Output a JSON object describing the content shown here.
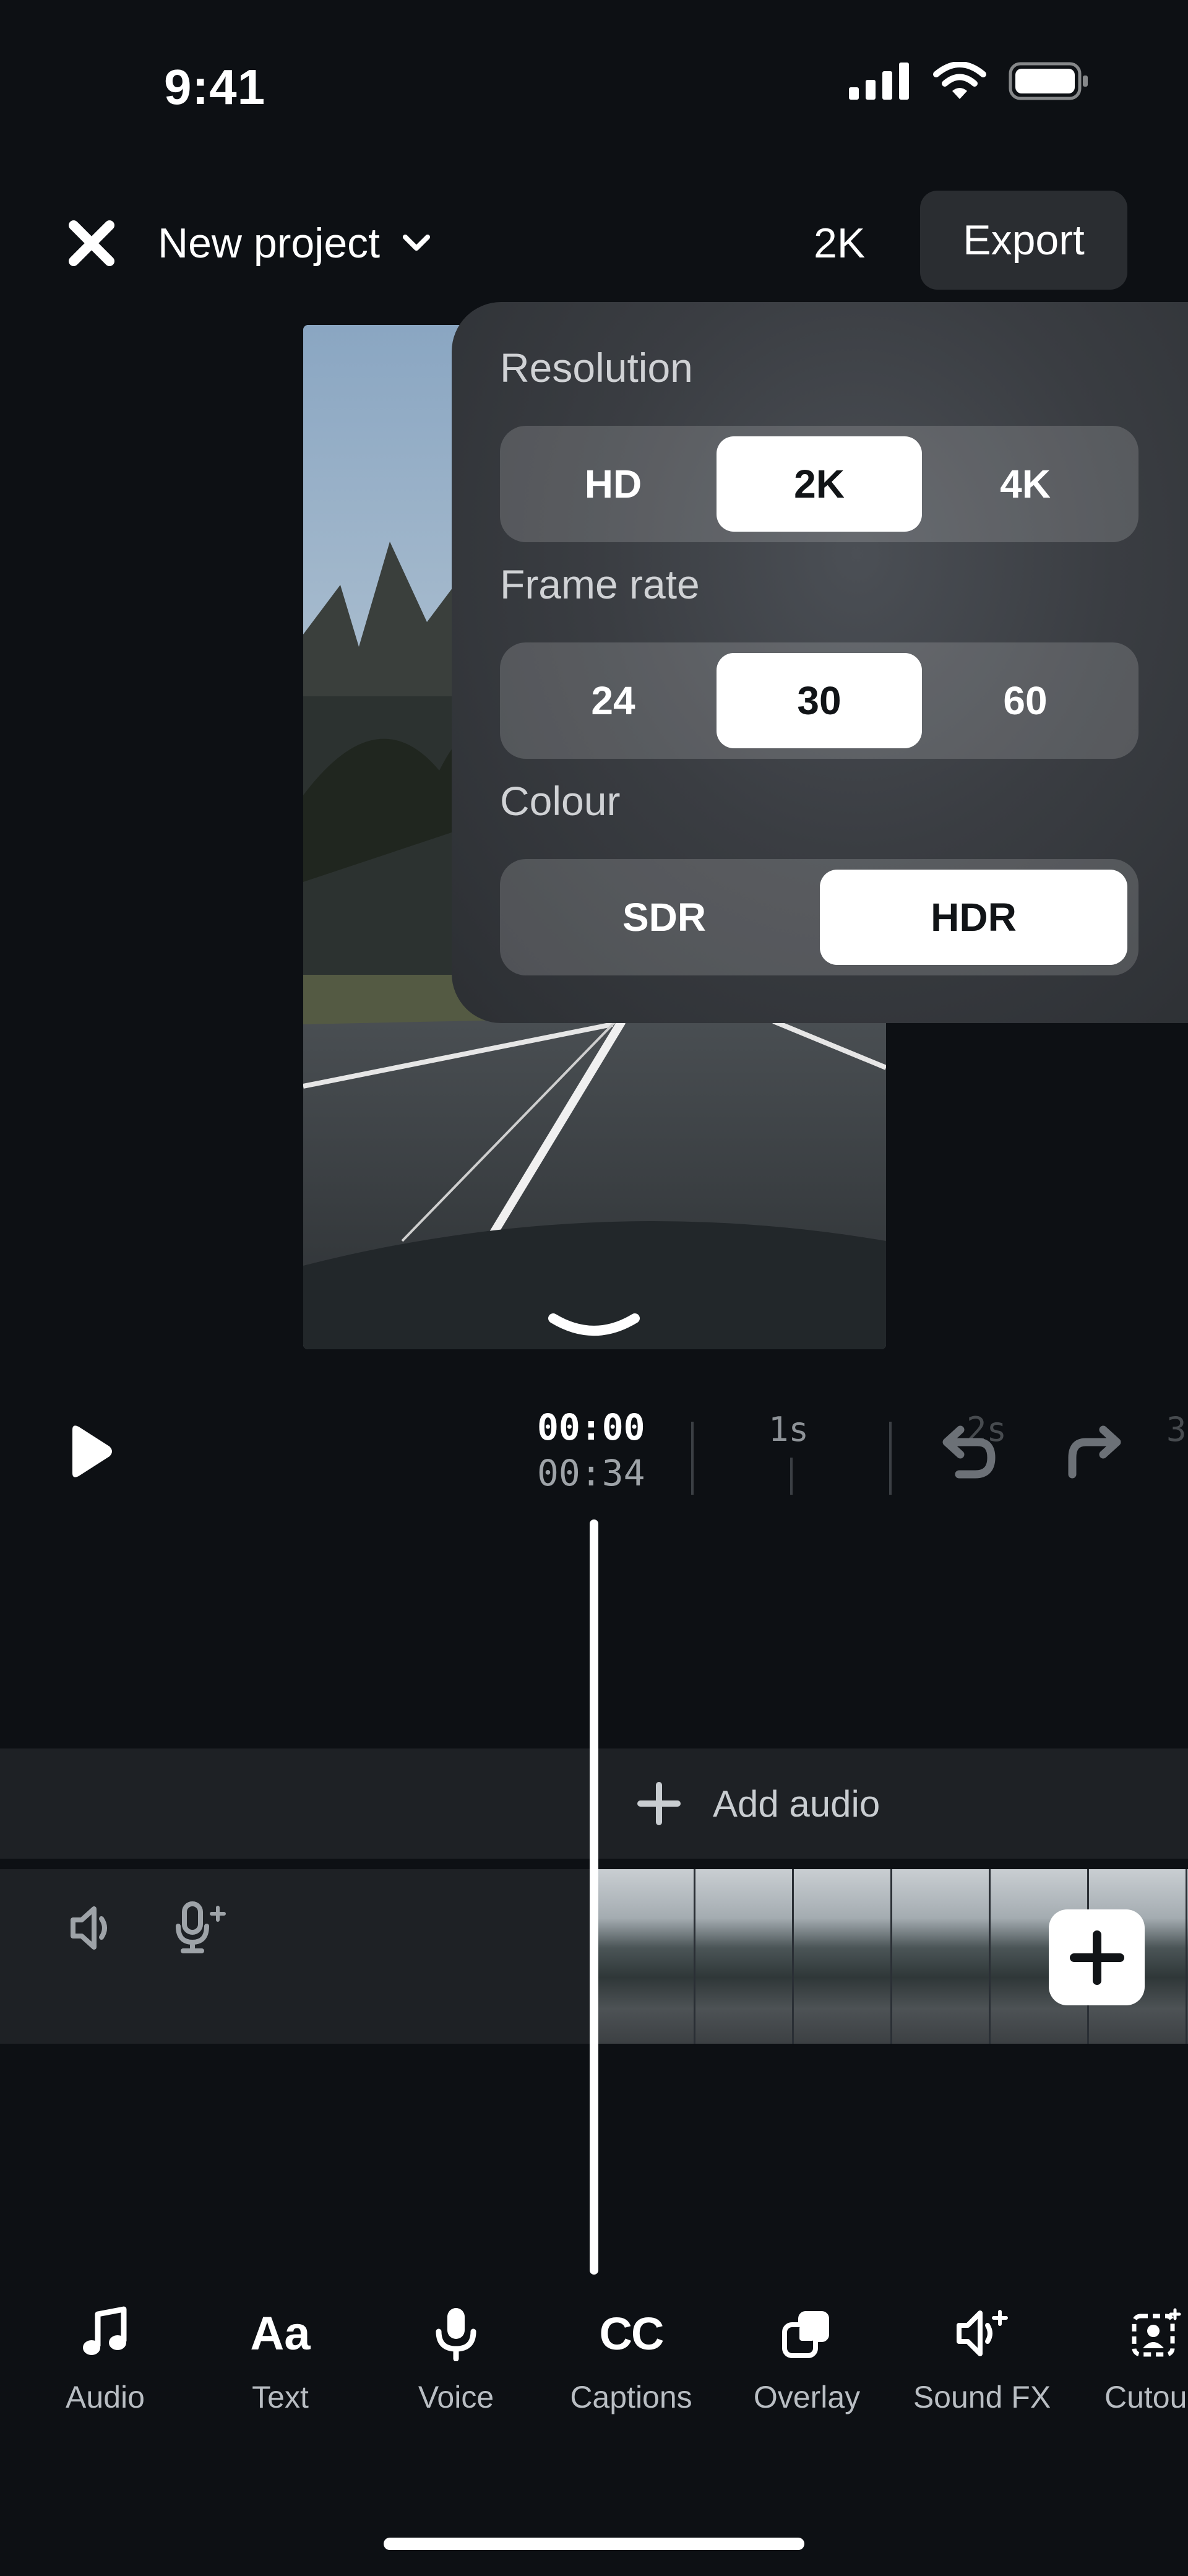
{
  "status_bar": {
    "time": "9:41"
  },
  "top_bar": {
    "project_title": "New project",
    "quality_label": "2K",
    "export_label": "Export"
  },
  "settings": {
    "resolution": {
      "label": "Resolution",
      "options": [
        "HD",
        "2K",
        "4K"
      ],
      "selected": "2K"
    },
    "frame_rate": {
      "label": "Frame rate",
      "options": [
        "24",
        "30",
        "60"
      ],
      "selected": "30"
    },
    "colour": {
      "label": "Colour",
      "options": [
        "SDR",
        "HDR"
      ],
      "selected": "HDR"
    }
  },
  "playback": {
    "current_time": "00:00",
    "total_time": "00:34",
    "ruler_labels": [
      "1s",
      "2s",
      "3"
    ]
  },
  "timeline": {
    "add_audio_label": "Add audio"
  },
  "toolbar": {
    "items": [
      {
        "label": "Audio",
        "icon": "music-note-icon"
      },
      {
        "label": "Text",
        "icon": "text-aa-icon"
      },
      {
        "label": "Voice",
        "icon": "microphone-icon"
      },
      {
        "label": "Captions",
        "icon": "captions-cc-icon"
      },
      {
        "label": "Overlay",
        "icon": "overlay-icon"
      },
      {
        "label": "Sound FX",
        "icon": "sound-fx-icon"
      },
      {
        "label": "Cutou",
        "icon": "cutout-icon"
      }
    ]
  }
}
